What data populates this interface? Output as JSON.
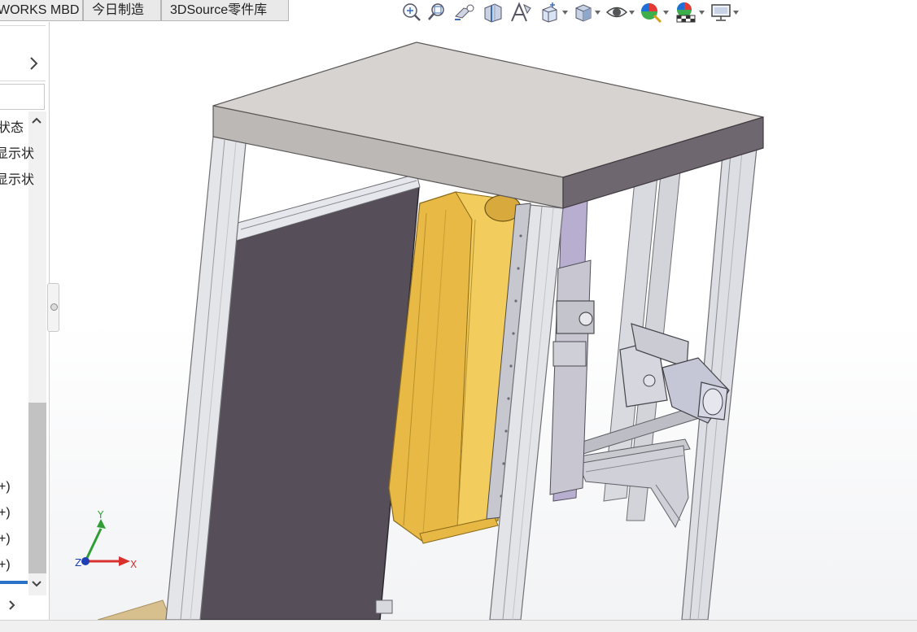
{
  "tabs": [
    {
      "label": "WORKS MBD"
    },
    {
      "label": "今日制造"
    },
    {
      "label": "3DSource零件库"
    }
  ],
  "hud_toolbar": [
    {
      "icon": "zoom-to-fit-icon"
    },
    {
      "icon": "zoom-to-area-icon"
    },
    {
      "icon": "previous-view-icon"
    },
    {
      "icon": "section-view-icon"
    },
    {
      "icon": "dynamic-annotation-views-icon"
    },
    {
      "icon": "view-orientation-icon",
      "dropdown": true
    },
    {
      "icon": "display-style-icon",
      "dropdown": true
    },
    {
      "icon": "hide-show-items-icon",
      "dropdown": true
    },
    {
      "icon": "edit-appearance-icon",
      "dropdown": true
    },
    {
      "icon": "apply-scene-icon",
      "dropdown": true
    },
    {
      "icon": "view-settings-icon",
      "dropdown": true
    }
  ],
  "panel": {
    "items": [
      {
        "label": "状态"
      },
      {
        "label": "显示状"
      },
      {
        "label": "显示状"
      }
    ],
    "list_suffixes": [
      "+)",
      "+)",
      "+)",
      "+)"
    ]
  },
  "triad": {
    "x": "X",
    "y": "Y",
    "z": "Z"
  },
  "colors": {
    "frame_light": "#e4e5e9",
    "top_plate": "#d6d3d0",
    "dark_panel": "#564f5a",
    "yellow_part": "#e6b845",
    "motor": "#c9cad8",
    "triad_x": "#d8322f",
    "triad_y": "#2f9e35",
    "triad_z": "#1f3fb5"
  }
}
